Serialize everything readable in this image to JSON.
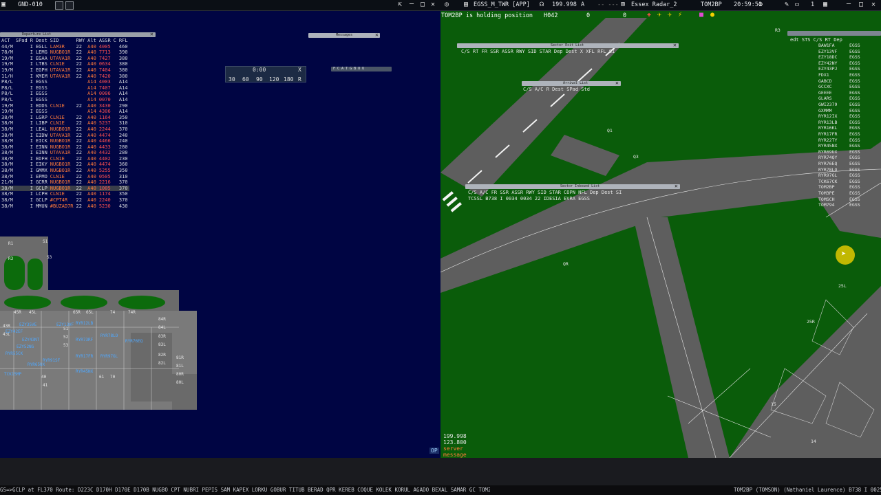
{
  "topbar": {
    "left_title": "GND-010",
    "center_title": "EGSS_M_TWR [APP]",
    "frequency": "199.998",
    "freq_mode": "A",
    "radar_label": "Essex Radar_2",
    "selected_callsign": "TOM2BP",
    "clock": "20:59:51",
    "status_msg": "TOM2BP is holding position",
    "heading_code": "H042",
    "counter1": "0",
    "counter2": "0",
    "counter3": "1"
  },
  "departure_list": {
    "title": "Departure List",
    "headers": [
      "ACT",
      "SPad",
      "R",
      "Dest",
      "SID",
      "RWY",
      "Alt",
      "ASSR",
      "C",
      "RFL"
    ],
    "rows": [
      [
        "44/M",
        "",
        "I",
        "EGLL",
        "LAM3R",
        "22",
        "A40",
        "4005",
        "",
        "460"
      ],
      [
        "78/M",
        "",
        "I",
        "LEMG",
        "NUGBO1R",
        "22",
        "A40",
        "7713",
        "",
        "390"
      ],
      [
        "19/M",
        "",
        "I",
        "EGAA",
        "UTAVA1R",
        "22",
        "A40",
        "7427",
        "",
        "380"
      ],
      [
        "19/M",
        "",
        "I",
        "LTBS",
        "CLN1E",
        "22",
        "A40",
        "0634",
        "",
        "380"
      ],
      [
        "19/M",
        "",
        "I",
        "EGPH",
        "UTAVA1R",
        "22",
        "A40",
        "7404",
        "",
        "380"
      ],
      [
        "11/H",
        "",
        "I",
        "KMEM",
        "UTAVA1R",
        "22",
        "A40",
        "7420",
        "",
        "380"
      ],
      [
        "P8/L",
        "",
        "I",
        "EGSS",
        "",
        "",
        "A14",
        "4003",
        "",
        "A14"
      ],
      [
        "P8/L",
        "",
        "I",
        "EGSS",
        "",
        "",
        "A14",
        "7407",
        "",
        "A14"
      ],
      [
        "P8/L",
        "",
        "I",
        "EGSS",
        "",
        "",
        "A14",
        "0006",
        "",
        "A14"
      ],
      [
        "P8/L",
        "",
        "I",
        "EGSS",
        "",
        "",
        "A14",
        "0070",
        "",
        "A14"
      ],
      [
        "19/M",
        "",
        "I",
        "EDDS",
        "CLN1E",
        "22",
        "A40",
        "3430",
        "",
        "290"
      ],
      [
        "19/M",
        "",
        "I",
        "EGSS",
        "",
        "",
        "A14",
        "4306",
        "",
        "A14"
      ],
      [
        "38/M",
        "",
        "I",
        "LGRP",
        "CLN1E",
        "22",
        "A40",
        "1164",
        "",
        "350"
      ],
      [
        "38/M",
        "",
        "I",
        "LIBP",
        "CLN1E",
        "22",
        "A40",
        "5237",
        "",
        "310"
      ],
      [
        "38/M",
        "",
        "I",
        "LEAL",
        "NUGBO1R",
        "22",
        "A40",
        "2244",
        "",
        "370"
      ],
      [
        "38/M",
        "",
        "I",
        "EIDW",
        "UTAVA1R",
        "22",
        "A40",
        "4474",
        "",
        "240"
      ],
      [
        "38/M",
        "",
        "I",
        "EICK",
        "NUGBO1R",
        "22",
        "A40",
        "4466",
        "",
        "240"
      ],
      [
        "38/M",
        "",
        "I",
        "EINN",
        "NUGBO1R",
        "22",
        "A40",
        "4433",
        "",
        "280"
      ],
      [
        "38/M",
        "",
        "I",
        "EINN",
        "UTAVA1R",
        "22",
        "A40",
        "4432",
        "",
        "280"
      ],
      [
        "38/M",
        "",
        "I",
        "EDFH",
        "CLN1E",
        "22",
        "A40",
        "4402",
        "",
        "230"
      ],
      [
        "38/M",
        "",
        "I",
        "EIKY",
        "NUGBO1R",
        "22",
        "A40",
        "4474",
        "",
        "360"
      ],
      [
        "38/M",
        "",
        "I",
        "GMMX",
        "NUGBO1R",
        "22",
        "A40",
        "5255",
        "",
        "350"
      ],
      [
        "38/M",
        "",
        "I",
        "EPMO",
        "CLN1E",
        "22",
        "A40",
        "0505",
        "",
        "310"
      ],
      [
        "21/M",
        "",
        "I",
        "GCRR",
        "NUGBO1R",
        "22",
        "A40",
        "2216",
        "",
        "370"
      ],
      [
        "38/M",
        "",
        "I",
        "GCLP",
        "NUGBO1R",
        "22",
        "A40",
        "1005",
        "",
        "370"
      ],
      [
        "38/M",
        "",
        "I",
        "LCPH",
        "CLN1E",
        "22",
        "A40",
        "1174",
        "",
        "350"
      ],
      [
        "38/M",
        "",
        "I",
        "GCLP",
        "#CPT4R",
        "22",
        "A40",
        "2240",
        "",
        "370"
      ],
      [
        "38/M",
        "",
        "I",
        "MMUN",
        "#BUZAD7R",
        "22",
        "A40",
        "5230",
        "",
        "430"
      ]
    ]
  },
  "messages_title": "Messages",
  "timer": {
    "value": "0:00",
    "close": "X",
    "options": [
      "30",
      "60",
      "90",
      "120",
      "180"
    ],
    "reset": "R"
  },
  "fcatgbou": "F C A T G B O U",
  "stand_labels": [
    "R1",
    "R3",
    "S1",
    "S3",
    "45R",
    "45L",
    "43R",
    "43L",
    "65R",
    "65L",
    "74",
    "74R",
    "84R",
    "84L",
    "83R",
    "83L",
    "82R",
    "82L",
    "81R",
    "81L",
    "80R",
    "80L",
    "51",
    "52",
    "53",
    "40",
    "41",
    "70",
    "61"
  ],
  "stand_callsigns": [
    "EZY35VE",
    "EZY13VF",
    "RYR12LB",
    "EZY42EF",
    "RYR73RF",
    "RYR78LO",
    "EZY43NT",
    "RYR76EQ",
    "RYR55CK",
    "RYR17FR",
    "RYR97GL",
    "TCK15MP",
    "RYR65UX",
    "RYR91SF",
    "EZY52NG",
    "RYR45NX"
  ],
  "sector_exit": {
    "title": "Sector Exit List",
    "headers": [
      "C/S",
      "RT",
      "FR",
      "SSR",
      "ASSR",
      "RWY",
      "SID",
      "STAR",
      "Dep",
      "Dest",
      "X",
      "XFL",
      "RFL",
      "SI"
    ]
  },
  "arrival": {
    "title": "Arrival List",
    "headers": [
      "C/S",
      "A/C",
      "R",
      "Dest",
      "SPad",
      "Std"
    ]
  },
  "sector_inbound": {
    "title": "Sector Inbound List",
    "headers": [
      "C/S",
      "A/C",
      "FR",
      "SSR",
      "ASSR",
      "RWY",
      "SID",
      "STAR",
      "COPN",
      "NFL",
      "Dep",
      "Dest",
      "SI"
    ],
    "row": [
      "TCSSL",
      "B738",
      "I",
      "0034",
      "0034",
      "22",
      "",
      "IDESIA",
      "",
      "",
      "EVRA",
      "EGSS",
      ""
    ]
  },
  "right_list": {
    "headers": [
      "edt",
      "STS",
      "C/S",
      "RT",
      "Dep"
    ],
    "callsigns": [
      "BAW1FA",
      "EZY13VF",
      "EZY18DC",
      "EZY42NY",
      "EZY43PJ",
      "FDX1",
      "GABCD",
      "GCCXC",
      "GEEEE",
      "GLARS",
      "GWI2379",
      "GXMMM",
      "RYR12IX",
      "RYR13LB",
      "RYR16KL",
      "RYR17FR",
      "RYR22TY",
      "RYR45NX",
      "RYR69UX",
      "RYR74QY",
      "RYR76EQ",
      "RYR78LO",
      "RYR97GL",
      "TCK67CK",
      "TOM2BP",
      "TOM3PE",
      "TOMSCH",
      "TOM794"
    ],
    "dep": "EGSS"
  },
  "taxi_labels": [
    "Q1",
    "Q3",
    "QR",
    "R3",
    "25L",
    "25R",
    "15",
    "14"
  ],
  "freq_panel": {
    "primary": "199.998",
    "secondary": "123.800",
    "server": "server",
    "message": "message"
  },
  "op_indicator": "OP",
  "command_line_left": "GS=>GCLP at FL370 Route: D223C D170H D170E D170B NUGBO CPT NUBRI PEPIS SAM KAPEX LORKU GOBUR TITUB BERAD QPR KEREB COQUE KOLEK KORUL AGADO BEXAL SAMAR GC TOM2BP on 199.998",
  "command_line_right": "TOM2BP (TOMSON) (Nathaniel Laurence) B738 I 0025 (2225) EG",
  "colors": {
    "left_bg": "#000543",
    "grass": "#0a5c0a",
    "tarmac": "#5e5e5e",
    "callsign_blue": "#4fa8ff",
    "accent_orange": "#ff7a3a",
    "cursor_halo": "#f5d000"
  }
}
